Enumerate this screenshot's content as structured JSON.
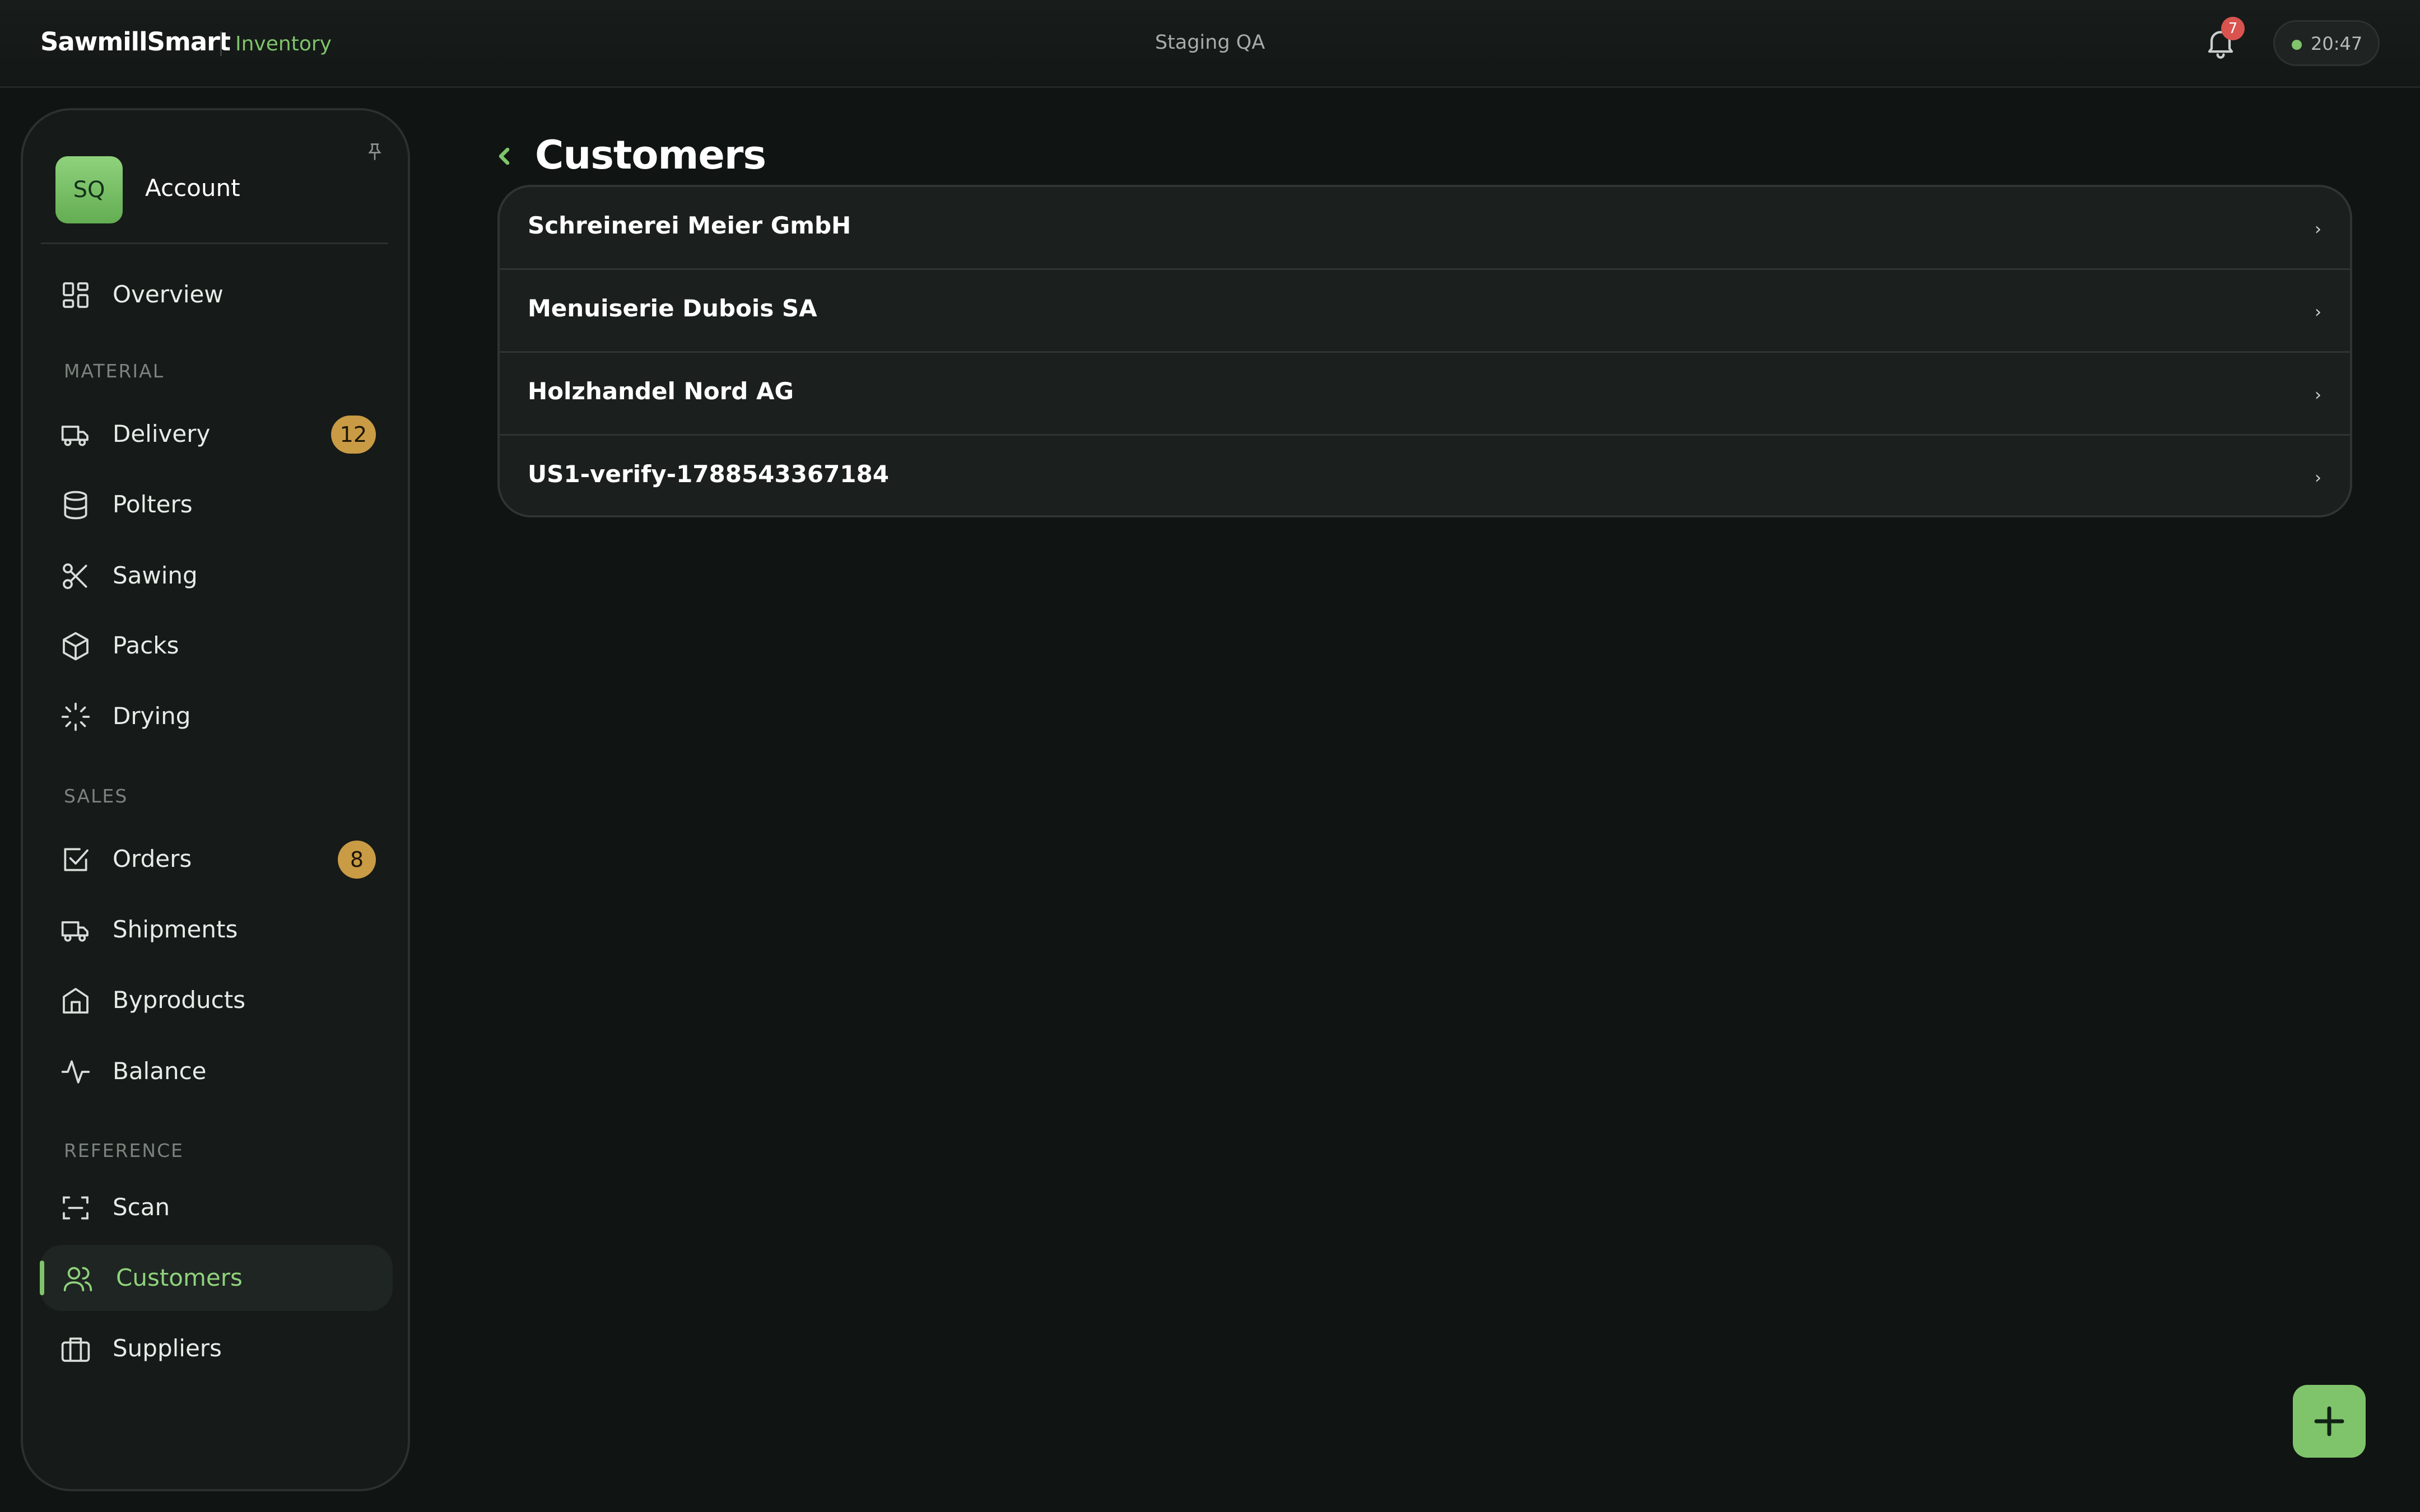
{
  "header": {
    "brand": "SawmillSmart",
    "module": "Inventory",
    "environment": "Staging QA",
    "notification_count": "7",
    "clock": "20:47"
  },
  "sidebar": {
    "account": {
      "initials": "SQ",
      "label": "Account"
    },
    "overview": "Overview",
    "sections": {
      "material": "MATERIAL",
      "sales": "SALES",
      "reference": "REFERENCE"
    },
    "items": {
      "delivery": {
        "label": "Delivery",
        "badge": "12"
      },
      "polters": {
        "label": "Polters"
      },
      "sawing": {
        "label": "Sawing"
      },
      "packs": {
        "label": "Packs"
      },
      "drying": {
        "label": "Drying"
      },
      "orders": {
        "label": "Orders",
        "badge": "8"
      },
      "shipments": {
        "label": "Shipments"
      },
      "byproducts": {
        "label": "Byproducts"
      },
      "balance": {
        "label": "Balance"
      },
      "scan": {
        "label": "Scan"
      },
      "customers": {
        "label": "Customers"
      },
      "suppliers": {
        "label": "Suppliers"
      }
    }
  },
  "main": {
    "title": "Customers",
    "customers": [
      {
        "name": "Schreinerei Meier GmbH"
      },
      {
        "name": "Menuiserie Dubois SA"
      },
      {
        "name": "Holzhandel Nord AG"
      },
      {
        "name": "US1-verify-1788543367184"
      }
    ]
  },
  "colors": {
    "accent": "#7fc46a",
    "badge": "#c99b45",
    "alert": "#d9534f"
  }
}
